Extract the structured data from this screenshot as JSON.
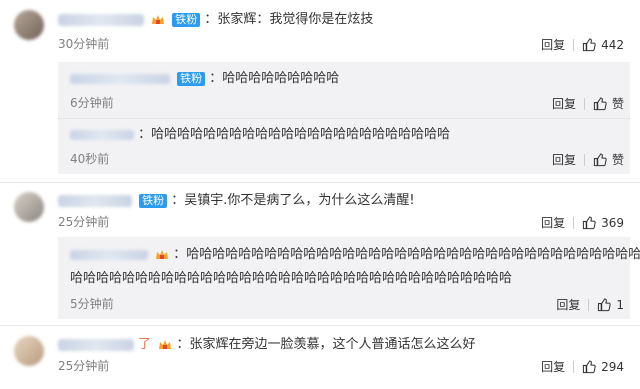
{
  "comments": [
    {
      "text": "：张家辉：我觉得你是在炫技",
      "badge": "铁粉",
      "time": "30分钟前",
      "reply_label": "回复",
      "likes": "442"
    },
    {
      "text": "：吴镇宇.你不是病了么，为什么这么清醒!",
      "badge": "铁粉",
      "time": "25分钟前",
      "reply_label": "回复",
      "likes": "369"
    },
    {
      "text_prefix": "了",
      "text": "：张家辉在旁边一脸羡慕，这个人普通话怎么这么好",
      "time": "25分钟前",
      "reply_label": "回复",
      "likes": "294"
    }
  ],
  "replies": [
    {
      "text": "：哈哈哈哈哈哈哈哈哈",
      "badge": "铁粉",
      "time": "6分钟前",
      "reply_label": "回复",
      "like_label": "赞"
    },
    {
      "text": "：哈哈哈哈哈哈哈哈哈哈哈哈哈哈哈哈哈哈哈哈哈哈哈",
      "time": "40秒前",
      "reply_label": "回复",
      "like_label": "赞"
    },
    {
      "text_line1": "：哈哈哈哈哈哈哈哈哈哈哈哈哈哈哈哈哈哈哈哈哈哈哈哈哈哈哈哈哈哈哈哈哈哈哈",
      "text_line2": "哈哈哈哈哈哈哈哈哈哈哈哈哈哈哈哈哈哈哈哈哈哈哈哈哈哈哈哈哈哈哈哈哈哈",
      "time": "5分钟前",
      "reply_label": "回复",
      "likes": "1"
    }
  ]
}
